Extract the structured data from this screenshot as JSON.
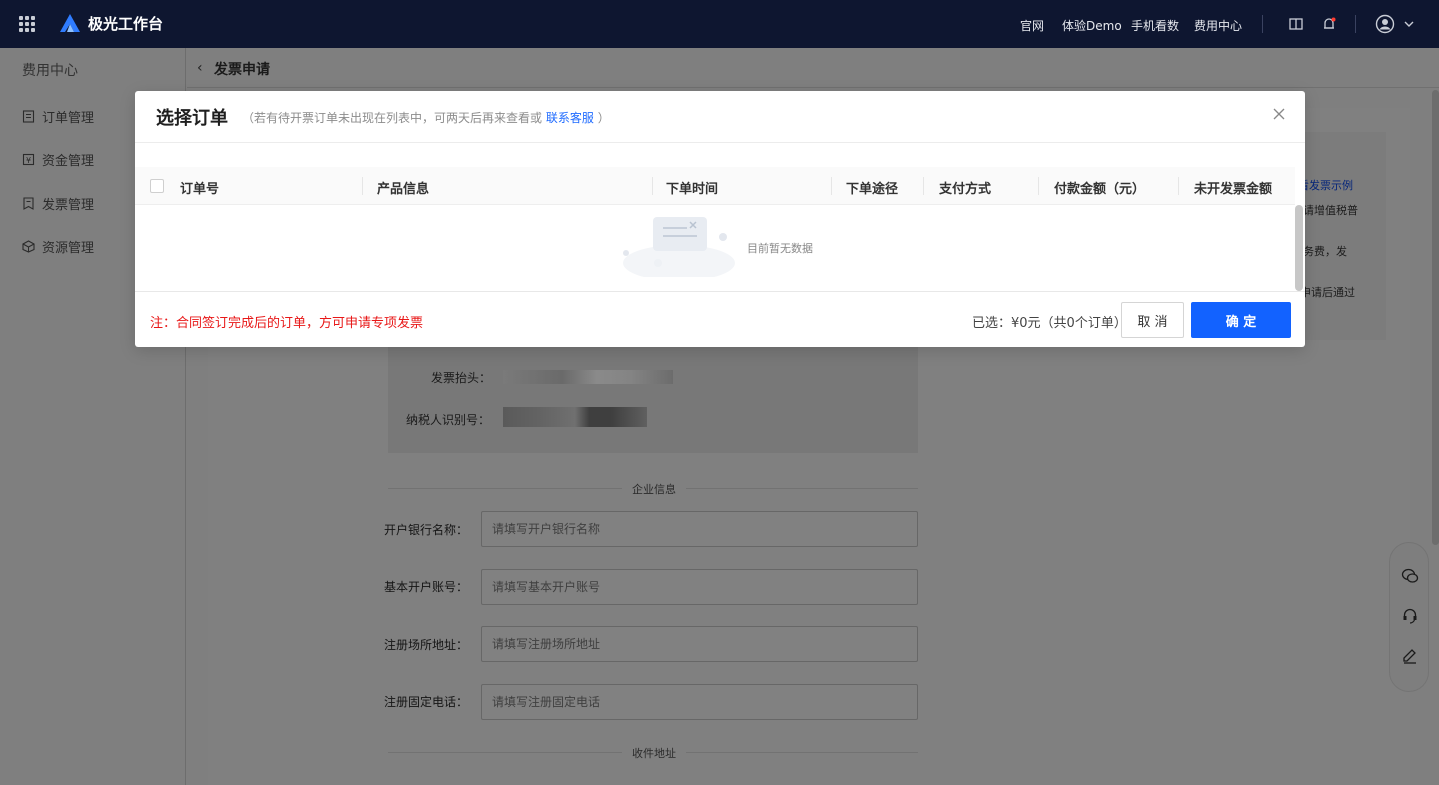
{
  "topbar": {
    "brand": "极光工作台",
    "nav": [
      "官网",
      "体验Demo",
      "手机看数",
      "费用中心"
    ]
  },
  "sidebar": {
    "title": "费用中心",
    "items": [
      {
        "label": "订单管理",
        "icon": "order-icon"
      },
      {
        "label": "资金管理",
        "icon": "fund-icon"
      },
      {
        "label": "发票管理",
        "icon": "invoice-icon"
      },
      {
        "label": "资源管理",
        "icon": "resource-icon"
      }
    ]
  },
  "page": {
    "back": "‹",
    "title": "发票申请"
  },
  "background": {
    "tips": [
      "查看发票示例",
      "申请增值税普",
      "服务费，发",
      "申请后通过"
    ],
    "invoice_header_label": "发票抬头：",
    "tax_id_label": "纳税人识别号：",
    "section_company": "企业信息",
    "section_address": "收件地址",
    "fields": [
      {
        "label": "开户银行名称：",
        "placeholder": "请填写开户银行名称"
      },
      {
        "label": "基本开户账号：",
        "placeholder": "请填写基本开户账号"
      },
      {
        "label": "注册场所地址：",
        "placeholder": "请填写注册场所地址"
      },
      {
        "label": "注册固定电话：",
        "placeholder": "请填写注册固定电话"
      }
    ]
  },
  "modal": {
    "title": "选择订单",
    "subtitle_prefix": "（若有待开票订单未出现在列表中，可两天后再来查看或",
    "subtitle_link": "联系客服",
    "subtitle_suffix": "）",
    "columns": [
      "订单号",
      "产品信息",
      "下单时间",
      "下单途径",
      "支付方式",
      "付款金额（元）",
      "未开发票金额"
    ],
    "empty_text": "目前暂无数据",
    "note": "注：合同签订完成后的订单，方可申请专项发票",
    "selected_summary": "已选：¥0元（共0个订单）",
    "cancel_label": "取 消",
    "confirm_label": "确 定"
  },
  "colors": {
    "accent": "#1262ff",
    "topbar_bg": "#0e1630",
    "note": "#e81717",
    "link": "#1f6bff"
  }
}
